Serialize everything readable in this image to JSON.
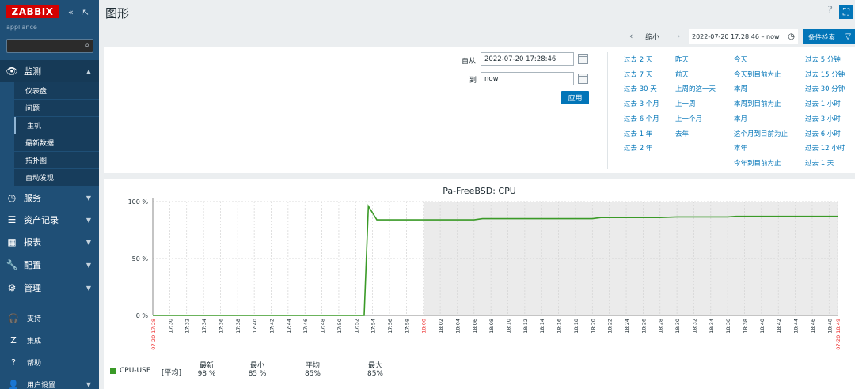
{
  "app": {
    "logo": "ZABBIX",
    "subtitle": "appliance"
  },
  "sidebar": {
    "collapse_icon": "«",
    "kiosk_icon": "⇱",
    "search_placeholder": "",
    "sections": [
      {
        "icon": "eye-icon",
        "label": "监测",
        "expanded": true
      },
      {
        "icon": "clock-icon",
        "label": "服务"
      },
      {
        "icon": "list-icon",
        "label": "资产记录"
      },
      {
        "icon": "bar-chart-icon",
        "label": "报表"
      },
      {
        "icon": "wrench-icon",
        "label": "配置"
      },
      {
        "icon": "gear-icon",
        "label": "管理"
      }
    ],
    "monitoring_items": [
      "仪表盘",
      "问题",
      "主机",
      "最新数据",
      "拓扑图",
      "自动发现"
    ],
    "bottom_items": [
      {
        "icon": "headset-icon",
        "label": "支持"
      },
      {
        "icon": "integrations-icon",
        "label": "集成"
      },
      {
        "icon": "help-icon",
        "label": "帮助"
      },
      {
        "icon": "user-icon",
        "label": "用户设置"
      }
    ]
  },
  "header": {
    "title": "图形",
    "help": "?"
  },
  "filterbar": {
    "prev": "‹",
    "zoom_out": "缩小",
    "next": "›",
    "range": "2022-07-20 17:28:46 – now",
    "filter_label": "条件检索"
  },
  "timepanel": {
    "from_label": "自从",
    "from_value": "2022-07-20 17:28:46",
    "to_label": "到",
    "to_value": "now",
    "apply": "应用",
    "quick_col1": [
      "过去 2 天",
      "过去 7 天",
      "过去 30 天",
      "过去 3 个月",
      "过去 6 个月",
      "过去 1 年",
      "过去 2 年"
    ],
    "quick_col2": [
      "昨天",
      "前天",
      "上周的这一天",
      "上一周",
      "上一个月",
      "去年"
    ],
    "quick_col3": [
      "今天",
      "今天到目前为止",
      "本周",
      "本周到目前为止",
      "本月",
      "这个月到目前为止",
      "本年",
      "今年到目前为止"
    ],
    "quick_col4": [
      "过去 5 分钟",
      "过去 15 分钟",
      "过去 30 分钟",
      "过去 1 小时",
      "过去 3 小时",
      "过去 6 小时",
      "过去 12 小时",
      "过去 1 天"
    ]
  },
  "chart_data": {
    "type": "line",
    "title": "Pa-FreeBSD: CPU",
    "y_ticks": [
      "100 %",
      "50 %",
      "0 %"
    ],
    "ylim": [
      0,
      100
    ],
    "x_tick_labels": [
      "07-20 17:28",
      "17:30",
      "17:32",
      "17:34",
      "17:36",
      "17:38",
      "17:40",
      "17:42",
      "17:44",
      "17:46",
      "17:48",
      "17:50",
      "17:52",
      "17:54",
      "17:56",
      "17:58",
      "18:00",
      "18:02",
      "18:04",
      "18:06",
      "18:08",
      "18:10",
      "18:12",
      "18:14",
      "18:16",
      "18:18",
      "18:20",
      "18:22",
      "18:24",
      "18:26",
      "18:28",
      "18:30",
      "18:32",
      "18:34",
      "18:36",
      "18:38",
      "18:40",
      "18:42",
      "18:44",
      "18:46",
      "18:48",
      "07-20 18:49"
    ],
    "red_ticks": [
      "07-20 17:28",
      "18:00",
      "07-20 18:49"
    ],
    "no_data_shading_from": "18:00",
    "series": [
      {
        "name": "CPU-USE",
        "color": "#3a9a27",
        "points": [
          [
            "17:28",
            0
          ],
          [
            "17:52",
            0
          ],
          [
            "17:53",
            0
          ],
          [
            "17:53.5",
            96
          ],
          [
            "17:54.5",
            84
          ],
          [
            "17:59",
            84
          ],
          [
            "18:06",
            84
          ],
          [
            "18:07",
            85
          ],
          [
            "18:12",
            85
          ],
          [
            "18:13",
            85
          ],
          [
            "18:20",
            85
          ],
          [
            "18:21",
            86
          ],
          [
            "18:28",
            86
          ],
          [
            "18:30",
            86.5
          ],
          [
            "18:36",
            86.5
          ],
          [
            "18:37",
            87
          ],
          [
            "18:49",
            87
          ]
        ]
      }
    ],
    "legend": {
      "series_name": "CPU-USE",
      "function": "[平均]",
      "columns": [
        {
          "label": "最新",
          "value": "98 %"
        },
        {
          "label": "最小",
          "value": "85 %"
        },
        {
          "label": "平均",
          "value": "85%"
        },
        {
          "label": "最大",
          "value": "85%"
        }
      ]
    }
  }
}
